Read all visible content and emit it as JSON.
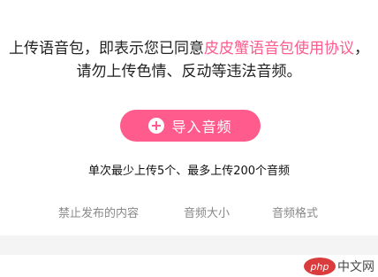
{
  "agreement": {
    "line1_prefix": "上传语音包，即表示您已同意",
    "line1_link": "皮皮蟹语音包使用协议",
    "line1_suffix": "，",
    "line2": "请勿上传色情、反动等违法音频。"
  },
  "import_button": {
    "label": "导入音频",
    "icon": "plus-icon",
    "color": "#ff5b8d"
  },
  "upload_limit": "单次最少上传5个、最多上传200个音频",
  "tabs": [
    {
      "label": "禁止发布的内容"
    },
    {
      "label": "音频大小"
    },
    {
      "label": "音频格式"
    }
  ],
  "watermark": {
    "logo_text": "php",
    "site_text": "中文网"
  }
}
